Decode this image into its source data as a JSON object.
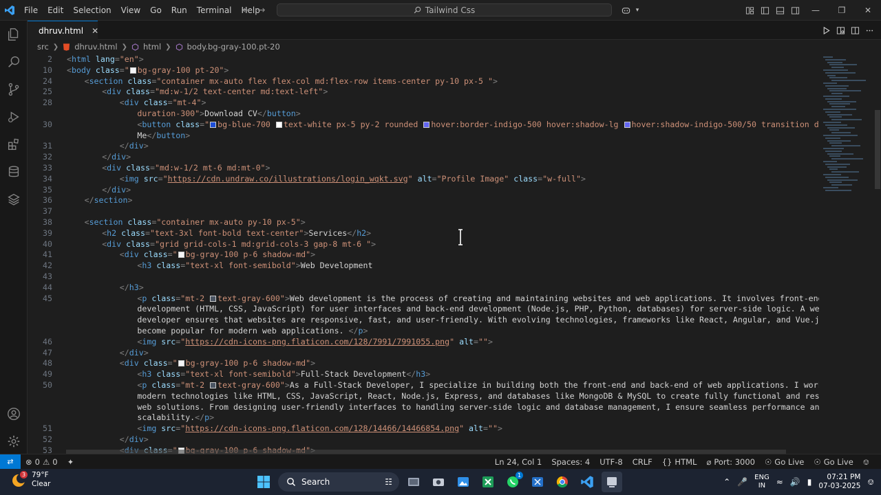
{
  "titlebar": {
    "menu": [
      "File",
      "Edit",
      "Selection",
      "View",
      "Go",
      "Run",
      "Terminal",
      "Help"
    ],
    "search_text": "Tailwind Css"
  },
  "tab": {
    "label": "dhruv.html"
  },
  "breadcrumb": {
    "folder": "src",
    "file": "dhruv.html",
    "el1": "html",
    "el2": "body.bg-gray-100.pt-20"
  },
  "editor": {
    "lines": [
      {
        "n": "2",
        "indent": 0,
        "parts": [
          [
            "p",
            "<"
          ],
          [
            "t",
            "html"
          ],
          [
            "a",
            " lang"
          ],
          [
            "p",
            "="
          ],
          [
            "s",
            "\"en\""
          ],
          [
            "p",
            ">"
          ]
        ]
      },
      {
        "n": "10",
        "indent": 0,
        "parts": [
          [
            "p",
            "<"
          ],
          [
            "t",
            "body"
          ],
          [
            "a",
            " class"
          ],
          [
            "p",
            "="
          ],
          [
            "s",
            "\""
          ],
          [
            "sw",
            "gray100"
          ],
          [
            "s",
            "bg-gray-100 pt-20\""
          ],
          [
            "p",
            ">"
          ]
        ]
      },
      {
        "n": "24",
        "indent": 1,
        "parts": [
          [
            "p",
            "<"
          ],
          [
            "t",
            "section"
          ],
          [
            "a",
            " class"
          ],
          [
            "p",
            "="
          ],
          [
            "s",
            "\"container mx-auto flex flex-col md:flex-row items-center py-10 px-5 \""
          ],
          [
            "p",
            ">"
          ]
        ]
      },
      {
        "n": "25",
        "indent": 2,
        "parts": [
          [
            "p",
            "<"
          ],
          [
            "t",
            "div"
          ],
          [
            "a",
            " class"
          ],
          [
            "p",
            "="
          ],
          [
            "s",
            "\"md:w-1/2 text-center md:text-left\""
          ],
          [
            "p",
            ">"
          ]
        ]
      },
      {
        "n": "28",
        "indent": 3,
        "parts": [
          [
            "p",
            "<"
          ],
          [
            "t",
            "div"
          ],
          [
            "a",
            " class"
          ],
          [
            "p",
            "="
          ],
          [
            "s",
            "\"mt-4\""
          ],
          [
            "p",
            ">"
          ]
        ]
      },
      {
        "n": "",
        "indent": 4,
        "parts": [
          [
            "s",
            "duration-300\""
          ],
          [
            "p",
            ">"
          ],
          [
            "txt",
            "Download CV"
          ],
          [
            "p",
            "</"
          ],
          [
            "t",
            "button"
          ],
          [
            "p",
            ">"
          ]
        ]
      },
      {
        "n": "30",
        "indent": 4,
        "parts": [
          [
            "p",
            "<"
          ],
          [
            "t",
            "button"
          ],
          [
            "a",
            " class"
          ],
          [
            "p",
            "="
          ],
          [
            "s",
            "\""
          ],
          [
            "sw",
            "blue700"
          ],
          [
            "s",
            "bg-blue-700 "
          ],
          [
            "sw",
            "white"
          ],
          [
            "s",
            "text-white px-5 py-2 rounded "
          ],
          [
            "sw",
            "indigo500"
          ],
          [
            "s",
            "hover:border-indigo-500 hover:shadow-lg "
          ],
          [
            "sw",
            "indigo500"
          ],
          [
            "s",
            "hover:shadow-indigo-500/50 transition duration-300"
          ]
        ]
      },
      {
        "n": "",
        "indent": 4,
        "parts": [
          [
            "txt",
            "Me"
          ],
          [
            "p",
            "</"
          ],
          [
            "t",
            "button"
          ],
          [
            "p",
            ">"
          ]
        ]
      },
      {
        "n": "31",
        "indent": 3,
        "parts": [
          [
            "p",
            "</"
          ],
          [
            "t",
            "div"
          ],
          [
            "p",
            ">"
          ]
        ]
      },
      {
        "n": "32",
        "indent": 2,
        "parts": [
          [
            "p",
            "</"
          ],
          [
            "t",
            "div"
          ],
          [
            "p",
            ">"
          ]
        ]
      },
      {
        "n": "33",
        "indent": 2,
        "parts": [
          [
            "p",
            "<"
          ],
          [
            "t",
            "div"
          ],
          [
            "a",
            " class"
          ],
          [
            "p",
            "="
          ],
          [
            "s",
            "\"md:w-1/2 mt-6 md:mt-0\""
          ],
          [
            "p",
            ">"
          ]
        ]
      },
      {
        "n": "34",
        "indent": 3,
        "parts": [
          [
            "p",
            "<"
          ],
          [
            "t",
            "img"
          ],
          [
            "a",
            " src"
          ],
          [
            "p",
            "="
          ],
          [
            "s",
            "\""
          ],
          [
            "u",
            "https://cdn.undraw.co/illustrations/login_wqkt.svg"
          ],
          [
            "s",
            "\""
          ],
          [
            "a",
            " alt"
          ],
          [
            "p",
            "="
          ],
          [
            "s",
            "\"Profile Image\""
          ],
          [
            "a",
            " class"
          ],
          [
            "p",
            "="
          ],
          [
            "s",
            "\"w-full\""
          ],
          [
            "p",
            ">"
          ]
        ]
      },
      {
        "n": "35",
        "indent": 2,
        "parts": [
          [
            "p",
            "</"
          ],
          [
            "t",
            "div"
          ],
          [
            "p",
            ">"
          ]
        ]
      },
      {
        "n": "36",
        "indent": 1,
        "parts": [
          [
            "p",
            "</"
          ],
          [
            "t",
            "section"
          ],
          [
            "p",
            ">"
          ]
        ]
      },
      {
        "n": "37",
        "indent": 0,
        "parts": []
      },
      {
        "n": "38",
        "indent": 1,
        "parts": [
          [
            "p",
            "<"
          ],
          [
            "t",
            "section"
          ],
          [
            "a",
            " class"
          ],
          [
            "p",
            "="
          ],
          [
            "s",
            "\"container mx-auto py-10 px-5\""
          ],
          [
            "p",
            ">"
          ]
        ]
      },
      {
        "n": "39",
        "indent": 2,
        "parts": [
          [
            "p",
            "<"
          ],
          [
            "t",
            "h2"
          ],
          [
            "a",
            " class"
          ],
          [
            "p",
            "="
          ],
          [
            "s",
            "\"text-3xl font-bold text-center\""
          ],
          [
            "p",
            ">"
          ],
          [
            "txt",
            "Services"
          ],
          [
            "p",
            "</"
          ],
          [
            "t",
            "h2"
          ],
          [
            "p",
            ">"
          ]
        ]
      },
      {
        "n": "40",
        "indent": 2,
        "parts": [
          [
            "p",
            "<"
          ],
          [
            "t",
            "div"
          ],
          [
            "a",
            " class"
          ],
          [
            "p",
            "="
          ],
          [
            "s",
            "\"grid grid-cols-1 md:grid-cols-3 gap-8 mt-6 \""
          ],
          [
            "p",
            ">"
          ]
        ]
      },
      {
        "n": "41",
        "indent": 3,
        "parts": [
          [
            "p",
            "<"
          ],
          [
            "t",
            "div"
          ],
          [
            "a",
            " class"
          ],
          [
            "p",
            "="
          ],
          [
            "s",
            "\""
          ],
          [
            "sw",
            "gray100"
          ],
          [
            "s",
            "bg-gray-100 p-6 shadow-md\""
          ],
          [
            "p",
            ">"
          ]
        ]
      },
      {
        "n": "42",
        "indent": 4,
        "parts": [
          [
            "p",
            "<"
          ],
          [
            "t",
            "h3"
          ],
          [
            "a",
            " class"
          ],
          [
            "p",
            "="
          ],
          [
            "s",
            "\"text-xl font-semibold\""
          ],
          [
            "p",
            ">"
          ],
          [
            "txt",
            "Web Development"
          ]
        ]
      },
      {
        "n": "43",
        "indent": 0,
        "parts": []
      },
      {
        "n": "44",
        "indent": 3,
        "parts": [
          [
            "p",
            "</"
          ],
          [
            "t",
            "h3"
          ],
          [
            "p",
            ">"
          ]
        ]
      },
      {
        "n": "45",
        "indent": 4,
        "parts": [
          [
            "p",
            "<"
          ],
          [
            "t",
            "p"
          ],
          [
            "a",
            " class"
          ],
          [
            "p",
            "="
          ],
          [
            "s",
            "\"mt-2 "
          ],
          [
            "sw",
            "gray600"
          ],
          [
            "s",
            "text-gray-600\""
          ],
          [
            "p",
            ">"
          ],
          [
            "txt",
            "Web development is the process of creating and maintaining websites and web applications. It involves front-end"
          ]
        ]
      },
      {
        "n": "",
        "indent": 4,
        "parts": [
          [
            "txt",
            "development (HTML, CSS, JavaScript) for user interfaces and back-end development (Node.js, PHP, Python, databases) for server-side logic. A web"
          ]
        ]
      },
      {
        "n": "",
        "indent": 4,
        "parts": [
          [
            "txt",
            "developer ensures that websites are responsive, fast, and user-friendly. With evolving technologies, frameworks like React, Angular, and Vue.js have"
          ]
        ]
      },
      {
        "n": "",
        "indent": 4,
        "parts": [
          [
            "txt",
            "become popular for modern web applications. "
          ],
          [
            "p",
            "</"
          ],
          [
            "t",
            "p"
          ],
          [
            "p",
            ">"
          ]
        ]
      },
      {
        "n": "46",
        "indent": 4,
        "parts": [
          [
            "p",
            "<"
          ],
          [
            "t",
            "img"
          ],
          [
            "a",
            " src"
          ],
          [
            "p",
            "="
          ],
          [
            "s",
            "\""
          ],
          [
            "u",
            "https://cdn-icons-png.flaticon.com/128/7991/7991055.png"
          ],
          [
            "s",
            "\""
          ],
          [
            "a",
            " alt"
          ],
          [
            "p",
            "="
          ],
          [
            "s",
            "\"\""
          ],
          [
            "p",
            ">"
          ]
        ]
      },
      {
        "n": "47",
        "indent": 3,
        "parts": [
          [
            "p",
            "</"
          ],
          [
            "t",
            "div"
          ],
          [
            "p",
            ">"
          ]
        ]
      },
      {
        "n": "48",
        "indent": 3,
        "parts": [
          [
            "p",
            "<"
          ],
          [
            "t",
            "div"
          ],
          [
            "a",
            " class"
          ],
          [
            "p",
            "="
          ],
          [
            "s",
            "\""
          ],
          [
            "sw",
            "gray100"
          ],
          [
            "s",
            "bg-gray-100 p-6 shadow-md\""
          ],
          [
            "p",
            ">"
          ]
        ]
      },
      {
        "n": "49",
        "indent": 4,
        "parts": [
          [
            "p",
            "<"
          ],
          [
            "t",
            "h3"
          ],
          [
            "a",
            " class"
          ],
          [
            "p",
            "="
          ],
          [
            "s",
            "\"text-xl font-semibold\""
          ],
          [
            "p",
            ">"
          ],
          [
            "txt",
            "Full-Stack Development"
          ],
          [
            "p",
            "</"
          ],
          [
            "t",
            "h3"
          ],
          [
            "p",
            ">"
          ]
        ]
      },
      {
        "n": "50",
        "indent": 4,
        "parts": [
          [
            "p",
            "<"
          ],
          [
            "t",
            "p"
          ],
          [
            "a",
            " class"
          ],
          [
            "p",
            "="
          ],
          [
            "s",
            "\"mt-2 "
          ],
          [
            "sw",
            "gray600"
          ],
          [
            "s",
            "text-gray-600\""
          ],
          [
            "p",
            ">"
          ],
          [
            "txt",
            "As a Full-Stack Developer, I specialize in building both the front-end and back-end of web applications. I work with"
          ]
        ]
      },
      {
        "n": "",
        "indent": 4,
        "parts": [
          [
            "txt",
            "modern technologies like HTML, CSS, JavaScript, React, Node.js, Express, and databases like MongoDB & MySQL to create fully functional and responsive"
          ]
        ]
      },
      {
        "n": "",
        "indent": 4,
        "parts": [
          [
            "txt",
            "web solutions. From designing user-friendly interfaces to handling server-side logic and database management, I ensure seamless performance and"
          ]
        ]
      },
      {
        "n": "",
        "indent": 4,
        "parts": [
          [
            "txt",
            "scalability."
          ],
          [
            "p",
            "</"
          ],
          [
            "t",
            "p"
          ],
          [
            "p",
            ">"
          ]
        ]
      },
      {
        "n": "51",
        "indent": 4,
        "parts": [
          [
            "p",
            "<"
          ],
          [
            "t",
            "img"
          ],
          [
            "a",
            " src"
          ],
          [
            "p",
            "="
          ],
          [
            "s",
            "\""
          ],
          [
            "u",
            "https://cdn-icons-png.flaticon.com/128/14466/14466854.png"
          ],
          [
            "s",
            "\""
          ],
          [
            "a",
            " alt"
          ],
          [
            "p",
            "="
          ],
          [
            "s",
            "\"\""
          ],
          [
            "p",
            ">"
          ]
        ]
      },
      {
        "n": "52",
        "indent": 3,
        "parts": [
          [
            "p",
            "</"
          ],
          [
            "t",
            "div"
          ],
          [
            "p",
            ">"
          ]
        ]
      },
      {
        "n": "53",
        "indent": 3,
        "parts": [
          [
            "p",
            "<"
          ],
          [
            "t",
            "div"
          ],
          [
            "a",
            " class"
          ],
          [
            "p",
            "="
          ],
          [
            "s",
            "\""
          ],
          [
            "sw",
            "gray100"
          ],
          [
            "s",
            "bg-gray-100 p-6 shadow-md\""
          ],
          [
            "p",
            ">"
          ]
        ]
      }
    ]
  },
  "statusbar": {
    "errors": "0",
    "warnings": "0",
    "position": "Ln 24, Col 1",
    "spaces": "Spaces: 4",
    "encoding": "UTF-8",
    "eol": "CRLF",
    "language": "HTML",
    "port": "Port: 3000",
    "golive1": "Go Live",
    "golive2": "Go Live"
  },
  "taskbar": {
    "temp": "79°F",
    "condition": "Clear",
    "weather_badge": "3",
    "search": "Search",
    "whatsapp_badge": "1",
    "lang1": "ENG",
    "lang2": "IN",
    "time": "07:21 PM",
    "date": "07-03-2025"
  },
  "colors": {
    "accent": "#0078d4",
    "editor_bg": "#1e1e1e",
    "tag": "#569cd6",
    "attr": "#9cdcfe",
    "string": "#ce9178"
  }
}
